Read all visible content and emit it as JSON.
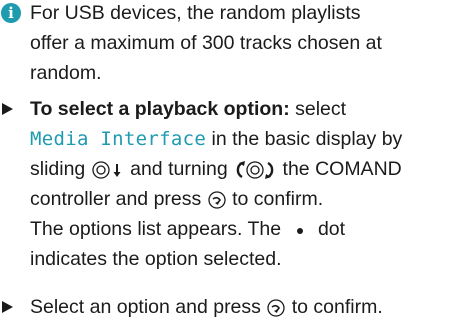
{
  "info": {
    "icon": "info-icon",
    "icon_glyph": "i",
    "lines": [
      "For USB devices, the random playlists",
      "offer a maximum of 300 tracks chosen at",
      "random."
    ]
  },
  "step1": {
    "bullet_icon": "triangle-bullet-icon",
    "bold_label": "To select a playback option:",
    "line1_rest": " select",
    "media_term": "Media Interface",
    "line2_rest": " in the basic display by",
    "line3_pre": "sliding ",
    "line3_mid": " and turning ",
    "line3_post": " the COMAND",
    "line4_pre": "controller and press ",
    "line4_post": " to confirm.",
    "line5": "The options list appears. The ",
    "line5_post": " dot",
    "line6": "indicates the option selected."
  },
  "step2": {
    "bullet_icon": "triangle-bullet-icon",
    "pre": "Select an option and press ",
    "post": " to confirm."
  },
  "colors": {
    "accent": "#1f9bb0",
    "text": "#1b1b1b"
  }
}
